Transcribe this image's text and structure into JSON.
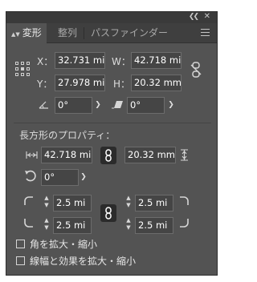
{
  "tabs": [
    {
      "label": "変形",
      "active": true
    },
    {
      "label": "整列",
      "active": false
    },
    {
      "label": "パスファインダー",
      "active": false
    }
  ],
  "transform": {
    "x_label": "X：",
    "x_value": "32.731 mi",
    "w_label": "W：",
    "w_value": "42.718 mi",
    "y_label": "Y：",
    "y_value": "27.978 mi",
    "h_label": "H：",
    "h_value": "20.32 mm",
    "rotate_value": "0°",
    "shear_value": "0°"
  },
  "rect": {
    "section_title": "長方形のプロパティ：",
    "width_value": "42.718 mi",
    "height_value": "20.32 mm",
    "angle_value": "0°",
    "corner_tl": "2.5 mi",
    "corner_tr": "2.5 mi",
    "corner_bl": "2.5 mi",
    "corner_br": "2.5 mi"
  },
  "options": {
    "scale_corners_label": "角を拡大・縮小",
    "scale_corners_checked": false,
    "scale_strokes_label": "線幅と効果を拡大・縮小",
    "scale_strokes_checked": false
  },
  "icons": {
    "collapse": "double-chevron-icon",
    "close": "close-icon",
    "menu": "panel-menu-icon",
    "link": "link-icon",
    "unlink": "unlink-icon"
  },
  "colors": {
    "panel_bg": "#535353",
    "tab_bar_bg": "#3f3f3f",
    "field_bg": "#454545",
    "text": "#dcdcdc"
  }
}
